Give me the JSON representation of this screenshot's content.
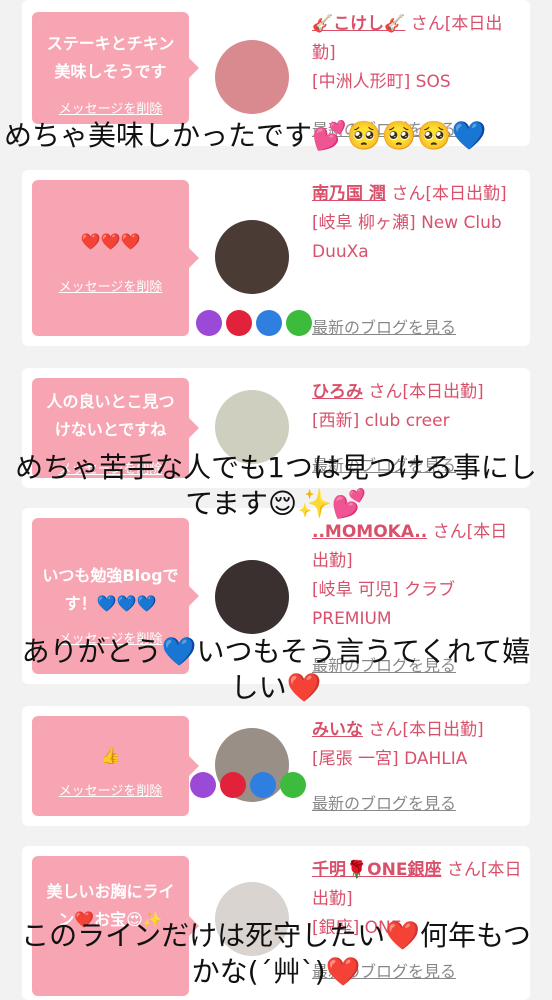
{
  "cards": [
    {
      "bubble": "ステーキとチキン美味しそうです",
      "delete_label": "メッセージを削除",
      "name": "🎸こけし🎸",
      "suffix": "さん[本日出勤]",
      "store": "[中洲人形町] SOS",
      "blog_label": "最新のブログを見る",
      "avatar_color": "#d88a8f"
    },
    {
      "bubble": "❤️❤️❤️",
      "delete_label": "メッセージを削除",
      "name": "南乃国 潤",
      "suffix": "さん[本日出勤]",
      "store": "[岐阜 柳ヶ瀬] New Club DuuXa",
      "blog_label": "最新のブログを見る",
      "avatar_color": "#4a3b34"
    },
    {
      "bubble": "人の良いとこ見つけないとですね",
      "delete_label": "メッセージを削除",
      "name": "ひろみ",
      "suffix": "さん[本日出勤]",
      "store": "[西新] club creer",
      "blog_label": "最新のブログを見る",
      "avatar_color": "#cfcfc0"
    },
    {
      "bubble": "いつも勉強Blogです！💙💙💙",
      "delete_label": "メッセージを削除",
      "name": "..MOMOKA..",
      "suffix": "さん[本日出勤]",
      "store": "[岐阜 可児] クラブ PREMIUM",
      "blog_label": "最新のブログを見る",
      "avatar_color": "#3a3030"
    },
    {
      "bubble": "👍",
      "delete_label": "メッセージを削除",
      "name": "みいな",
      "suffix": "さん[本日出勤]",
      "store": "[尾張 一宮] DAHLIA",
      "blog_label": "最新のブログを見る",
      "avatar_color": "#9a8f87"
    },
    {
      "bubble": "美しいお胸にライン❤️お宝😍✨",
      "delete_label": "メッセージを削除",
      "name": "千明🌹ONE銀座",
      "suffix": "さん[本日出勤]",
      "store": "[銀座] ONE",
      "blog_label": "最新のブログを見る",
      "avatar_color": "#d9d4cf"
    }
  ],
  "overlays": {
    "o1": "めちゃ美味しかったです💕🥺🥺🥺💙",
    "o2": "めちゃ苦手な人でも1つは見つける事にしてます😌✨💕",
    "o3": "ありがとう💙いつもそう言うてくれて嬉しい❤️",
    "o4": "このラインだけは死守したい❤️何年もつかな(´艸`)❤️"
  }
}
